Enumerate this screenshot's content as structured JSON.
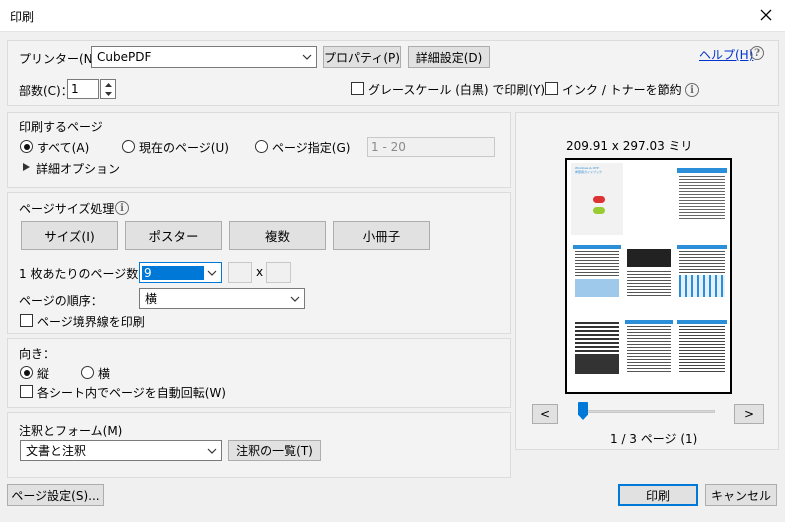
{
  "window": {
    "title": "印刷"
  },
  "top": {
    "printer_label": "プリンター(N)：",
    "printer_value": "CubePDF",
    "properties_button": "プロパティ(P)",
    "advanced_button": "詳細設定(D)",
    "help_link": "ヘルプ(H)",
    "copies_label": "部数(C)：",
    "copies_value": "1",
    "grayscale_label": "グレースケール (白黒) で印刷(Y)",
    "save_ink_label": "インク / トナーを節約"
  },
  "pages_to_print": {
    "heading": "印刷するページ",
    "all_label": "すべて(A)",
    "current_label": "現在のページ(U)",
    "range_label": "ページ指定(G)",
    "range_placeholder": "1 - 20",
    "more_options": "詳細オプション"
  },
  "page_sizing": {
    "heading": "ページサイズ処理",
    "size_button": "サイズ(I)",
    "poster_button": "ポスター",
    "multiple_button": "複数",
    "booklet_button": "小冊子",
    "pages_per_sheet_label": "1 枚あたりのページ数：",
    "pages_per_sheet_value": "9",
    "times_sign": "x",
    "order_label": "ページの順序：",
    "order_value": "横",
    "border_label": "ページ境界線を印刷"
  },
  "orientation": {
    "heading": "向き：",
    "portrait_label": "縦",
    "landscape_label": "横",
    "auto_rotate_label": "各シート内でページを自動回転(W)"
  },
  "comments": {
    "heading": "注釈とフォーム(M)",
    "value": "文書と注釈",
    "summary_button": "注釈の一覧(T)"
  },
  "preview": {
    "dimensions": "209.91 x 297.03 ミリ",
    "prev_button": "<",
    "next_button": ">",
    "page_indicator": "1 / 3 ページ (1)",
    "thumb_title_lines": [
      "Windows & OTP",
      "参照用ガイドブック"
    ]
  },
  "footer": {
    "page_setup_button": "ページ設定(S)...",
    "print_button": "印刷",
    "cancel_button": "キャンセル"
  },
  "colors": {
    "accent": "#0078d7",
    "selection": "#0078d7",
    "link": "#0033cc",
    "thumb_blue": "#2a8fd8"
  }
}
